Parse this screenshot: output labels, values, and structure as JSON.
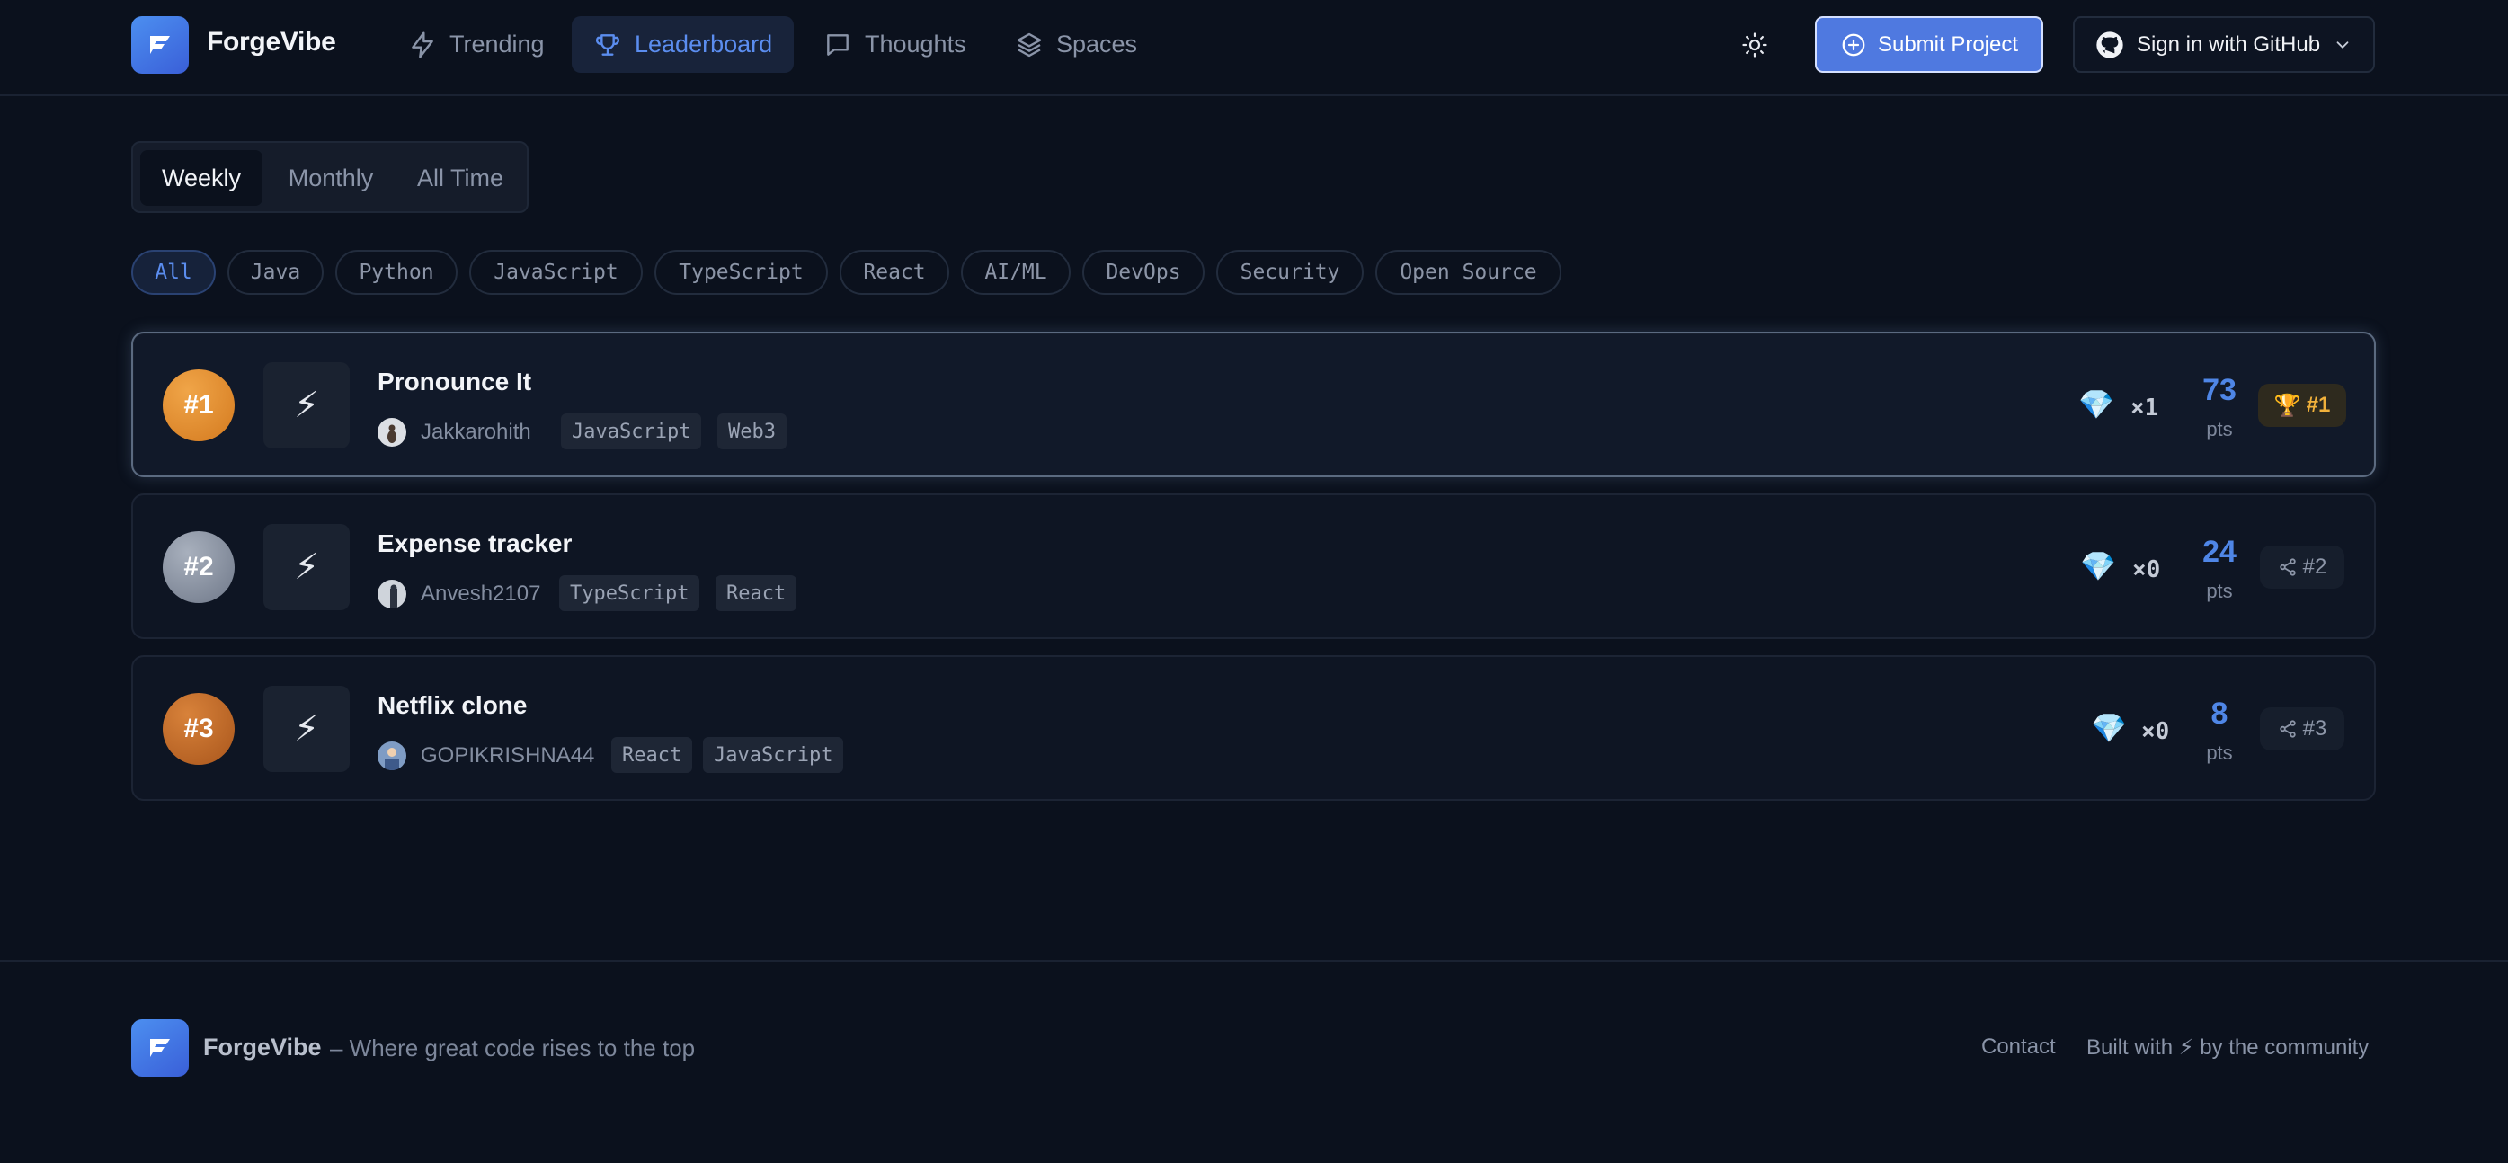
{
  "app": {
    "name": "ForgeVibe"
  },
  "nav": {
    "items": [
      {
        "label": "Trending",
        "icon": "lightning-icon",
        "active": false
      },
      {
        "label": "Leaderboard",
        "icon": "trophy-icon",
        "active": true
      },
      {
        "label": "Thoughts",
        "icon": "message-icon",
        "active": false
      },
      {
        "label": "Spaces",
        "icon": "layers-icon",
        "active": false
      }
    ],
    "theme_icon": "sun-icon",
    "submit_label": "Submit Project",
    "github_label": "Sign in with GitHub"
  },
  "period_tabs": [
    {
      "label": "Weekly",
      "active": true
    },
    {
      "label": "Monthly",
      "active": false
    },
    {
      "label": "All Time",
      "active": false
    }
  ],
  "filters": [
    {
      "label": "All",
      "active": true
    },
    {
      "label": "Java"
    },
    {
      "label": "Python"
    },
    {
      "label": "JavaScript"
    },
    {
      "label": "TypeScript"
    },
    {
      "label": "React"
    },
    {
      "label": "AI/ML"
    },
    {
      "label": "DevOps"
    },
    {
      "label": "Security"
    },
    {
      "label": "Open Source"
    }
  ],
  "leaderboard": [
    {
      "rank": "#1",
      "thumb": "⚡",
      "title": "Pronounce It",
      "author": "Jakkarohith",
      "tags": [
        "JavaScript",
        "Web3"
      ],
      "gems": "×1",
      "points": "73",
      "pts_label": "pts",
      "badge": "#1",
      "badge_icon": "trophy-icon"
    },
    {
      "rank": "#2",
      "thumb": "⚡",
      "title": "Expense tracker",
      "author": "Anvesh2107",
      "tags": [
        "TypeScript",
        "React"
      ],
      "gems": "×0",
      "points": "24",
      "pts_label": "pts",
      "badge": "#2",
      "badge_icon": "share-icon"
    },
    {
      "rank": "#3",
      "thumb": "⚡",
      "title": "Netflix clone",
      "author": "GOPIKRISHNA44",
      "tags": [
        "React",
        "JavaScript"
      ],
      "gems": "×0",
      "points": "8",
      "pts_label": "pts",
      "badge": "#3",
      "badge_icon": "share-icon"
    }
  ],
  "footer": {
    "brand": "ForgeVibe",
    "tagline": "– Where great code rises to the top",
    "contact": "Contact",
    "built": "Built with ⚡ by the community"
  },
  "colors": {
    "background": "#0b111d",
    "accent": "#5b8def",
    "gold": "#f1b13b",
    "rank1": "#e08a2c",
    "rank2": "#8a93a3",
    "rank3": "#c46a26"
  }
}
